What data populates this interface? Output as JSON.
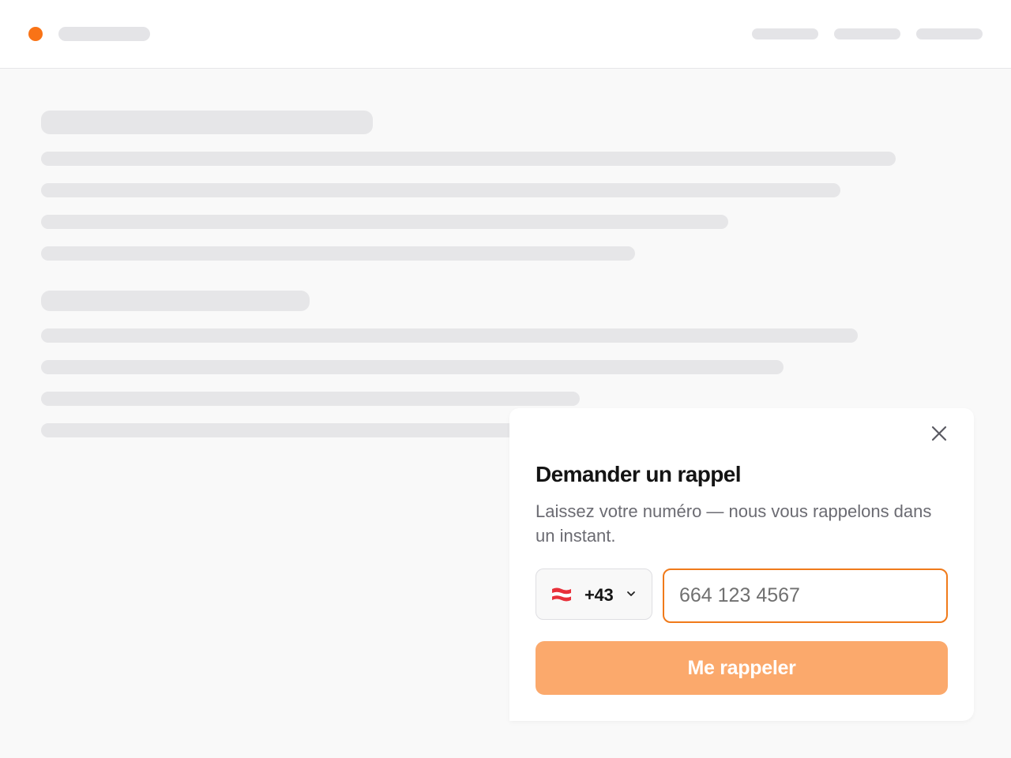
{
  "colors": {
    "brand": "#f97316",
    "skeleton": "#e6e6e8",
    "input_border": "#f07a1a",
    "cta_background": "#fba96c"
  },
  "callback_widget": {
    "close_icon": "close-icon",
    "title": "Demander un rappel",
    "description": "Laissez votre numéro — nous vous rappelons dans un instant.",
    "country": {
      "flag_icon": "austria-flag-icon",
      "dial_code": "+43",
      "dropdown_icon": "chevron-down-icon"
    },
    "phone": {
      "value": "",
      "placeholder": "664 123 4567"
    },
    "submit_label": "Me rappeler"
  }
}
